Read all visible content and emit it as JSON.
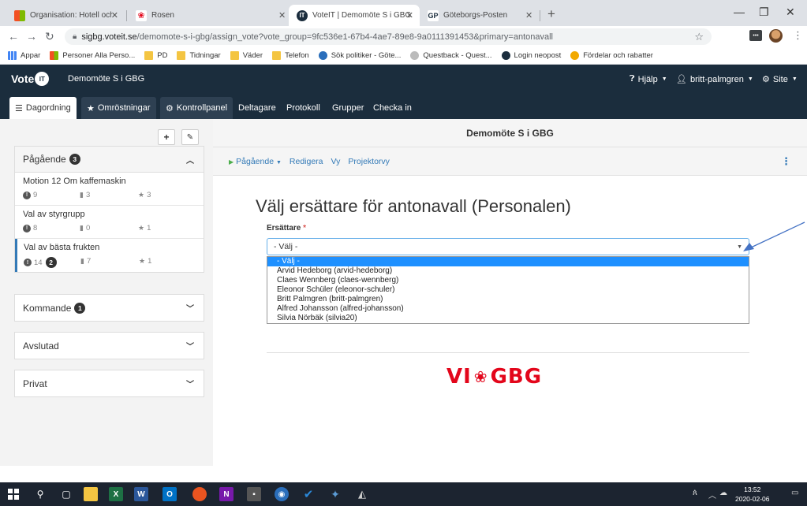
{
  "browser": {
    "tabs": [
      {
        "title": "Organisation: Hotell och restaurangbranschen"
      },
      {
        "title": "Rosen"
      },
      {
        "title": "VoteIT | Demomöte S i GBG"
      },
      {
        "title": "Göteborgs-Posten"
      }
    ],
    "url_host": "sigbg.voteit.se",
    "url_path": "/demomote-s-i-gbg/assign_vote?vote_group=9fc536e1-67b4-4ae7-89e8-9a0111391453&primary=antonavall",
    "bookmarks": [
      "Appar",
      "Personer Alla Perso...",
      "PD",
      "Tidningar",
      "Väder",
      "Telefon",
      "Sök politiker - Göte...",
      "Questback - Quest...",
      "Login neopost",
      "Fördelar och rabatter"
    ]
  },
  "app": {
    "logo": "Vote",
    "logo_badge": "IT",
    "meeting_name": "Demomöte S i GBG",
    "help_label": "Hjälp",
    "user_label": "britt-palmgren",
    "site_label": "Site",
    "tabs": [
      "Dagordning",
      "Omröstningar",
      "Kontrollpanel",
      "Deltagare",
      "Protokoll",
      "Grupper",
      "Checka in"
    ]
  },
  "sidebar": {
    "add_label": "+",
    "edit_label": "✎",
    "ongoing": {
      "title": "Pågående",
      "count": "3",
      "items": [
        {
          "title": "Motion 12 Om kaffemaskin",
          "proposals": "9",
          "discussion": "3",
          "votes": "3"
        },
        {
          "title": "Val av styrgrupp",
          "proposals": "8",
          "discussion": "0",
          "votes": "1"
        },
        {
          "title": "Val av bästa frukten",
          "proposals": "14",
          "proposals_badge": "2",
          "discussion": "7",
          "votes": "1"
        }
      ]
    },
    "upcoming": {
      "title": "Kommande",
      "count": "1"
    },
    "closed": {
      "title": "Avslutad"
    },
    "private": {
      "title": "Privat"
    }
  },
  "main": {
    "header": "Demomöte S i GBG",
    "subnav": {
      "ongoing": "Pågående",
      "edit": "Redigera",
      "view": "Vy",
      "projector": "Projektorvy"
    },
    "heading": "Välj ersättare för antonavall (Personalen)",
    "field_label": "Ersättare",
    "required_mark": "*",
    "select_value": "- Välj -",
    "options": [
      "- Välj -",
      "Arvid Hedeborg (arvid-hedeborg)",
      "Claes Wennberg (claes-wennberg)",
      "Eleonor Schüler (eleonor-schuler)",
      "Britt Palmgren (britt-palmgren)",
      "Alfred Johansson (alfred-johansson)",
      "Silvia Nörbäk (silvia20)"
    ],
    "logo_left": "VI",
    "logo_right": "GBG"
  },
  "taskbar": {
    "time": "13:52",
    "date": "2020-02-06"
  },
  "colors": {
    "navbar": "#1b2d3d",
    "link": "#337ab7",
    "highlight": "#1e90ff",
    "brand_red": "#e3061b"
  }
}
